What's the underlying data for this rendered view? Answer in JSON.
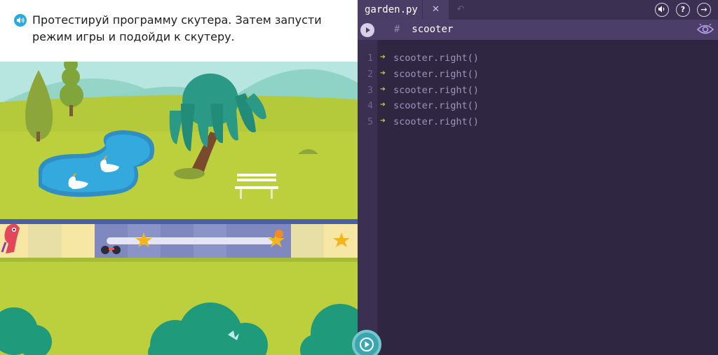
{
  "task": {
    "text": "Протестируй программу скутера. Затем запусти режим игры и подойди к скутеру."
  },
  "editor": {
    "tab_name": "garden.py",
    "close_symbol": "✕",
    "undo_symbol": "↶",
    "help_symbol": "?",
    "exit_symbol": "→",
    "comment_hash": "#",
    "comment_text": "scooter",
    "lines": [
      {
        "number": "1",
        "code": "scooter.right()"
      },
      {
        "number": "2",
        "code": "scooter.right()"
      },
      {
        "number": "3",
        "code": "scooter.right()"
      },
      {
        "number": "4",
        "code": "scooter.right()"
      },
      {
        "number": "5",
        "code": "scooter.right()"
      }
    ],
    "arrow_symbol": "➔"
  },
  "icons": {
    "sound": "speaker-icon",
    "volume": "volume-icon",
    "help": "help-icon",
    "exit": "exit-icon",
    "eye": "eye-icon",
    "run": "play-icon"
  },
  "colors": {
    "editor_bg": "#2f2742",
    "accent_run": "#3aa7b0",
    "code_arrow": "#c4d84a",
    "grass": "#bccf3c",
    "sky": "#b7e6e0"
  }
}
